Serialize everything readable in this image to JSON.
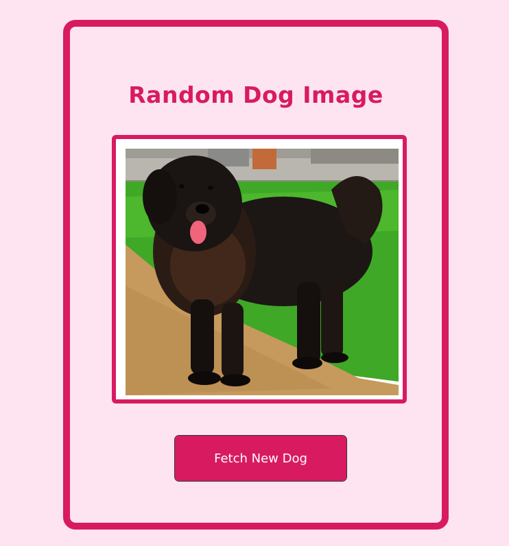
{
  "page": {
    "title": "Random Dog Image"
  },
  "image": {
    "alt": "Random dog"
  },
  "button": {
    "label": "Fetch New Dog"
  },
  "colors": {
    "background": "#fde4f0",
    "accent": "#d81b60",
    "button_text": "#ffffff"
  }
}
